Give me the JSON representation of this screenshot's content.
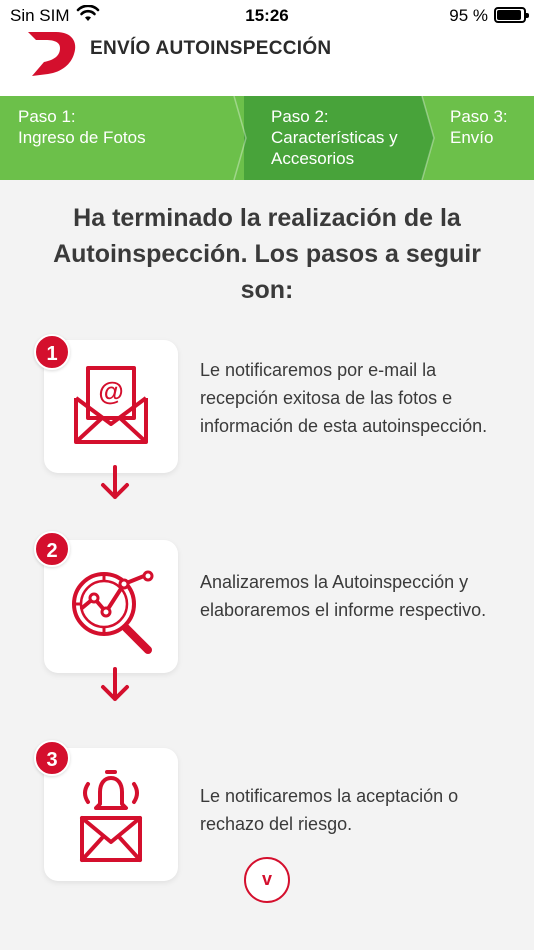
{
  "status_bar": {
    "carrier": "Sin SIM",
    "time": "15:26",
    "battery_percent": "95 %",
    "battery_level": 0.95
  },
  "header": {
    "title": "ENVÍO AUTOINSPECCIÓN"
  },
  "stepper": {
    "steps": [
      {
        "number": "Paso 1:",
        "label": "Ingreso de Fotos"
      },
      {
        "number": "Paso 2:",
        "label": "Características y Accesorios"
      },
      {
        "number": "Paso 3:",
        "label": "Envío"
      }
    ],
    "active_step": 2
  },
  "main": {
    "headline": "Ha terminado la realización de la Autoinspección. Los pasos a seguir son:",
    "next_steps": [
      {
        "badge": "1",
        "icon": "email-envelope-icon",
        "text": "Le notificaremos por e-mail la recepción exitosa de las fotos e información de esta autoinspección."
      },
      {
        "badge": "2",
        "icon": "magnifier-chart-icon",
        "text": "Analizaremos la Autoinspección y elaboraremos el informe respectivo."
      },
      {
        "badge": "3",
        "icon": "bell-envelope-icon",
        "text": "Le notificaremos la aceptación o rechazo del riesgo."
      }
    ],
    "more_button_label": "v"
  },
  "colors": {
    "accent_red": "#d40f2d",
    "stepper_green": "#6cc04a",
    "stepper_active_green": "#48a33a"
  }
}
